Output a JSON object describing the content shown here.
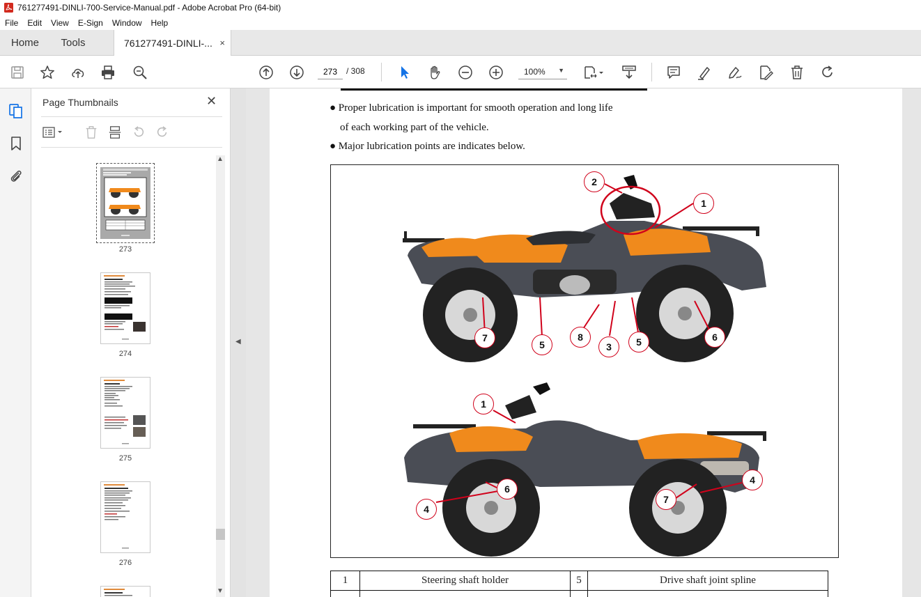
{
  "window": {
    "title": "761277491-DINLI-700-Service-Manual.pdf - Adobe Acrobat Pro (64-bit)"
  },
  "menu": [
    "File",
    "Edit",
    "View",
    "E-Sign",
    "Window",
    "Help"
  ],
  "tabs": {
    "home": "Home",
    "tools": "Tools",
    "document": "761277491-DINLI-...",
    "close": "×"
  },
  "toolbar": {
    "current_page": "273",
    "page_total": "/ 308",
    "zoom": "100%"
  },
  "thumbnails_panel": {
    "title": "Page Thumbnails",
    "pages": [
      {
        "label": "273",
        "selected": true
      },
      {
        "label": "274",
        "selected": false
      },
      {
        "label": "275",
        "selected": false
      },
      {
        "label": "276",
        "selected": false
      }
    ]
  },
  "document": {
    "bullet_1_line_1": "● Proper lubrication is important for smooth operation and long life",
    "bullet_1_line_2": "of each working part of the vehicle.",
    "bullet_2": "● Major lubrication points are indicates below.",
    "callouts_top": [
      "2",
      "1",
      "7",
      "5",
      "8",
      "3",
      "5",
      "6"
    ],
    "callouts_bottom": [
      "1",
      "6",
      "4",
      "7",
      "4"
    ],
    "table_row_1": {
      "num_a": "1",
      "item_a": "Steering shaft holder",
      "num_b": "5",
      "item_b": "Drive shaft joint spline"
    }
  },
  "colors": {
    "callout_ring": "#d0021b",
    "atv_orange": "#f08a1c",
    "atv_body": "#4a4d55",
    "acrobat_red": "#d22a1e",
    "select_arrow": "#1473e6"
  }
}
